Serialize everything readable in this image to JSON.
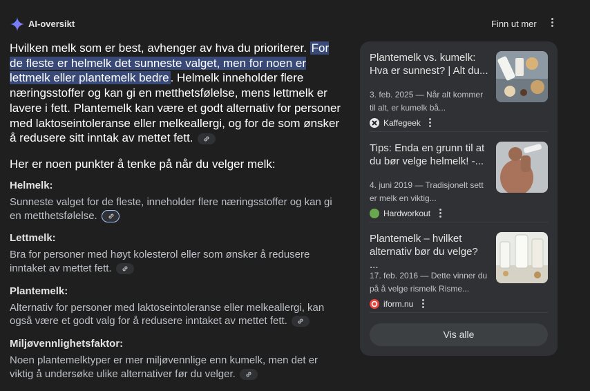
{
  "header": {
    "title": "AI-oversikt",
    "more_link": "Finn ut mer"
  },
  "intro": {
    "part1": "Hvilken melk som er best, avhenger av hva du prioriterer. ",
    "highlight": "For de fleste er helmelk det sunneste valget, men for noen er lettmelk eller plantemelk bedre",
    "part2": ". Helmelk inneholder flere næringsstoffer og kan gi en metthetsfølelse, mens lettmelk er lavere i fett. Plantemelk kan være et godt alternativ for personer med laktoseintoleranse eller melkeallergi, og for de som ønsker å redusere sitt inntak av mettet fett."
  },
  "subheading": "Her er noen punkter å tenke på når du velger melk:",
  "points": [
    {
      "title": "Helmelk:",
      "text": "Sunneste valget for de fleste, inneholder flere næringsstoffer og kan gi en metthetsfølelse."
    },
    {
      "title": "Lettmelk:",
      "text": "Bra for personer med høyt kolesterol eller som ønsker å redusere inntaket av mettet fett."
    },
    {
      "title": "Plantemelk:",
      "text": "Alternativ for personer med laktoseintoleranse eller melkeallergi, kan også være et godt valg for å redusere inntaket av mettet fett."
    },
    {
      "title": "Miljøvennlighetsfaktor:",
      "text": "Noen plantemelktyper er mer miljøvennlige enn kumelk, men det er viktig å undersøke ulike alternativer før du velger."
    }
  ],
  "sources": [
    {
      "title": "Plantemelk vs. kumelk: Hva er sunnest? | Alt du...",
      "snippet": "3. feb. 2025 — Når alt kommer til alt, er kumelk bå...",
      "site": "Kaffegeek"
    },
    {
      "title": "Tips: Enda en grunn til at du bør velge helmelk! -...",
      "snippet": "4. juni 2019 — Tradisjonelt sett er melk en viktig...",
      "site": "Hardworkout"
    },
    {
      "title": "Plantemelk – hvilket alternativ bør du velge? ...",
      "snippet": "17. feb. 2016 — Dette vinner du på å velge rismelk Risme...",
      "site": "iform.nu"
    }
  ],
  "show_all": "Vis alle",
  "colors": {
    "background": "#1f1f1f",
    "panel": "#303134",
    "highlight": "#394a78",
    "focus_ring": "#a8c7fa"
  }
}
